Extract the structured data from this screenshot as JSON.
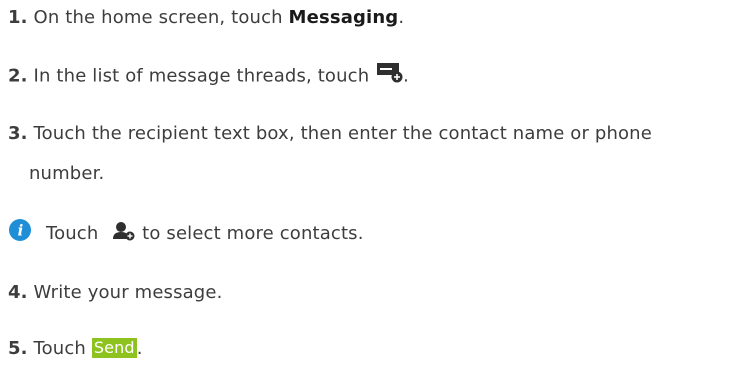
{
  "steps": [
    {
      "number": "1.",
      "text_before": "On the home screen, touch ",
      "bold": "Messaging",
      "text_after": "."
    },
    {
      "number": "2.",
      "text_before": "In the list of message threads, touch ",
      "icon": "new-message-icon",
      "text_after": "."
    },
    {
      "number": "3.",
      "text_line1": "Touch the recipient text box, then enter the contact name or phone",
      "text_line2": "number."
    },
    {
      "number": "4.",
      "text": "Write your message."
    },
    {
      "number": "5.",
      "text_before": "Touch ",
      "button_label": "Send",
      "text_after": "."
    }
  ],
  "note": {
    "icon": "info-icon",
    "text_before": "Touch ",
    "icon_inline": "add-contact-icon",
    "text_after": " to select more contacts."
  },
  "colors": {
    "text": "#3d3d3d",
    "info_icon": "#1e8fd6",
    "send_button": "#8dc21f",
    "icon_dark": "#2f2f2f"
  }
}
